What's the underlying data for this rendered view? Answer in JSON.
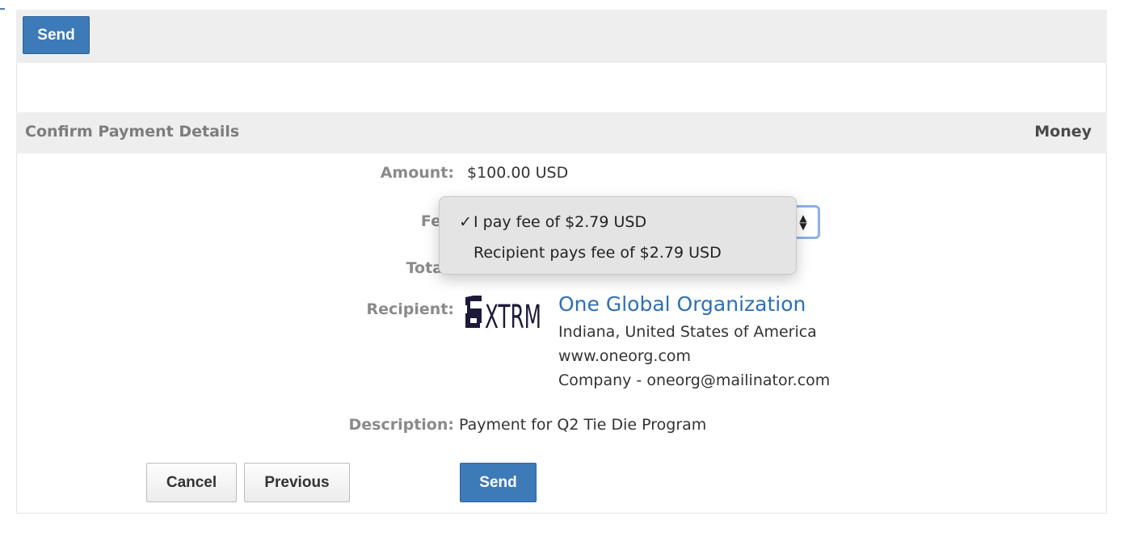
{
  "toolbar": {
    "send_label": "Send"
  },
  "section": {
    "title": "Confirm Payment Details",
    "right_label": "Money"
  },
  "fields": {
    "amount_label": "Amount:",
    "amount_value": "$100.00 USD",
    "fee_label": "Fe",
    "total_label": "Tota",
    "recipient_label": "Recipient:",
    "description_label": "Description:",
    "description_value": "Payment for Q2 Tie Die Program"
  },
  "fee_dropdown": {
    "options": [
      {
        "label": "I pay fee of $2.79 USD",
        "selected": true,
        "check": "✓"
      },
      {
        "label": "Recipient pays fee of $2.79 USD",
        "selected": false,
        "check": ""
      }
    ]
  },
  "recipient": {
    "logo_text": "XTRM",
    "name": "One Global Organization",
    "location": "Indiana, United States of America",
    "website": "www.oneorg.com",
    "contact": "Company - oneorg@mailinator.com"
  },
  "actions": {
    "cancel_label": "Cancel",
    "previous_label": "Previous",
    "send_label": "Send"
  },
  "colors": {
    "primary_button": "#3d7ab8",
    "link": "#2d6fb4",
    "header_bg": "#eeeeee",
    "label_gray": "#8a8a8a"
  }
}
